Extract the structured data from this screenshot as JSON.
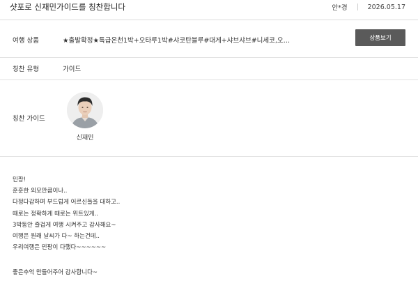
{
  "header": {
    "title": "샷포로 신재민가이드를 칭찬합니다",
    "author": "안*경",
    "date": "2026.05.17"
  },
  "product": {
    "label": "여행 상품",
    "value": "★출발확정★특급온천1박+오타루1박#샤코탄블루#대게+샤브샤브#니세코,오타루,...",
    "button_label": "상품보기"
  },
  "praise_type": {
    "label": "칭찬 유형",
    "value": "가이드"
  },
  "guide": {
    "label": "칭찬 가이드",
    "name": "신재민"
  },
  "content": {
    "lines": [
      "민팡!",
      "훈훈한 외모만큼이나..",
      "다정다감하며 부드럽게 어르신들을 대하고..",
      "때로는 정확하게 때로는 위트있게..",
      "3박동안 즐겁게 여행 시켜주고 감사해요~",
      "여행은 원래 날씨가 다~ 하는건데..",
      "우리여행은 민팡이 다했다~~~~~~"
    ],
    "closing": "좋은추억 만들어주어 감사합니다~"
  },
  "colors": {
    "button_bg": "#5a5a5a",
    "divider": "#e2e2e2"
  }
}
